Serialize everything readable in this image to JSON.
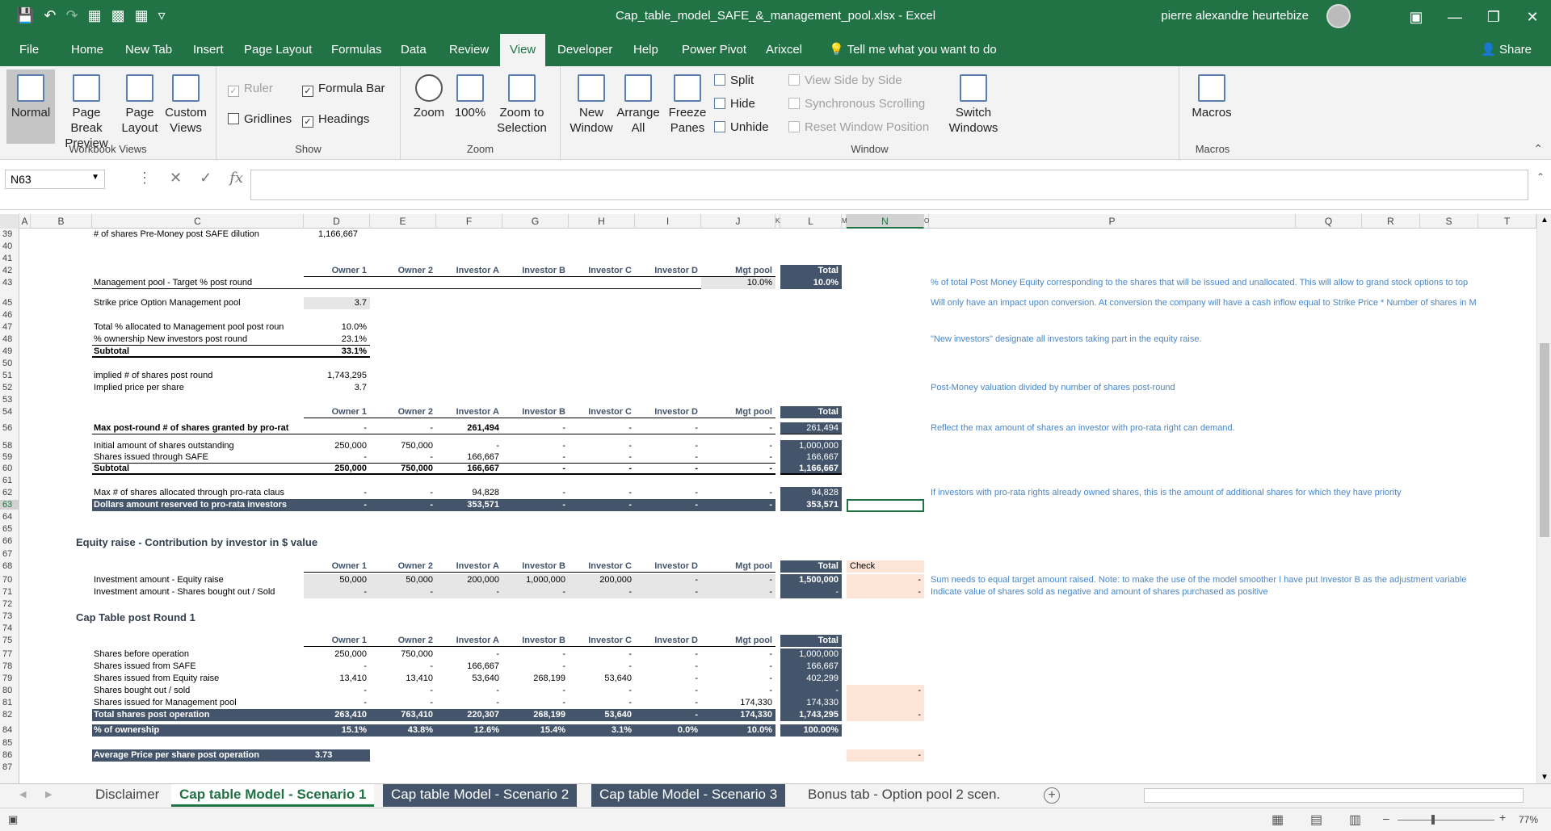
{
  "app": {
    "doc_title": "Cap_table_model_SAFE_&_management_pool.xlsx  -  Excel",
    "user": "pierre alexandre heurtebize",
    "share_label": "Share"
  },
  "menu": [
    "File",
    "Home",
    "New Tab",
    "Insert",
    "Page Layout",
    "Formulas",
    "Data",
    "Review",
    "View",
    "Developer",
    "Help",
    "Power Pivot",
    "Arixcel",
    "Tell me what you want to do"
  ],
  "ribbon": {
    "workbook_views": {
      "label": "Workbook Views",
      "normal": "Normal",
      "page_break": "Page Break Preview",
      "page_layout": "Page Layout",
      "custom_views": "Custom Views"
    },
    "show": {
      "label": "Show",
      "ruler": "Ruler",
      "formula_bar": "Formula Bar",
      "gridlines": "Gridlines",
      "headings": "Headings"
    },
    "zoom": {
      "label": "Zoom",
      "zoom": "Zoom",
      "hundred": "100%",
      "zoom_sel": "Zoom to Selection"
    },
    "window": {
      "label": "Window",
      "new_window": "New Window",
      "arrange": "Arrange All",
      "freeze": "Freeze Panes",
      "split": "Split",
      "hide": "Hide",
      "unhide": "Unhide",
      "side": "View Side by Side",
      "sync": "Synchronous Scrolling",
      "reset": "Reset Window Position",
      "switch": "Switch Windows"
    },
    "macros": {
      "label": "Macros",
      "macros": "Macros"
    }
  },
  "formula_bar": {
    "name_box": "N63",
    "formula": ""
  },
  "columns": [
    "A",
    "B",
    "C",
    "D",
    "E",
    "F",
    "G",
    "H",
    "I",
    "J",
    "K",
    "L",
    "M",
    "N",
    "O",
    "P",
    "Q",
    "R",
    "S",
    "T"
  ],
  "rows": [
    "39",
    "40",
    "41",
    "42",
    "43",
    "45",
    "46",
    "47",
    "48",
    "49",
    "50",
    "51",
    "52",
    "53",
    "54",
    "56",
    "58",
    "59",
    "60",
    "61",
    "62",
    "63",
    "64",
    "65",
    "66",
    "67",
    "68",
    "70",
    "71",
    "72",
    "73",
    "74",
    "75",
    "77",
    "78",
    "79",
    "80",
    "81",
    "82",
    "84",
    "85",
    "86",
    "87"
  ],
  "hdr": [
    "Owner 1",
    "Owner 2",
    "Investor A",
    "Investor B",
    "Investor C",
    "Investor D",
    "Mgt pool",
    "Total"
  ],
  "sheet": {
    "r39": {
      "label": "# of shares Pre-Money post SAFE dilution",
      "d": "1,166,667"
    },
    "r43": {
      "label": "Management pool - Target % post round",
      "j": "10.0%",
      "total": "10.0%",
      "note": "% of total Post Money Equity corresponding to the shares that will be issued and unallocated. This will allow to grand stock options to top"
    },
    "r45": {
      "label": "Strike price Option Management pool",
      "d": "3.7",
      "note": "Will only have an impact upon conversion. At conversion the company will have a cash inflow equal to Strike Price * Number of shares in M"
    },
    "r47": {
      "label": "Total % allocated to Management pool post roun",
      "d": "10.0%"
    },
    "r48": {
      "label": "% ownership New investors post round",
      "d": "23.1%",
      "note": "\"New investors\" designate all investors taking part in the equity raise."
    },
    "r49": {
      "label": "Subtotal",
      "d": "33.1%"
    },
    "r51": {
      "label": "implied # of shares post round",
      "d": "1,743,295"
    },
    "r52": {
      "label": "Implied price per share",
      "d": "3.7",
      "note": "Post-Money valuation divided by number of shares post-round"
    },
    "r56": {
      "label": "Max post-round # of shares granted by pro-rat",
      "vals": [
        "-",
        "-",
        "261,494",
        "-",
        "-",
        "-",
        "-",
        "261,494"
      ],
      "note": "Reflect the max amount of shares an investor with pro-rata right can demand."
    },
    "r58": {
      "label": "Initial amount of shares outstanding",
      "vals": [
        "250,000",
        "750,000",
        "-",
        "-",
        "-",
        "-",
        "-",
        "1,000,000"
      ]
    },
    "r59": {
      "label": "Shares issued through SAFE",
      "vals": [
        "-",
        "-",
        "166,667",
        "-",
        "-",
        "-",
        "-",
        "166,667"
      ]
    },
    "r60": {
      "label": "Subtotal",
      "vals": [
        "250,000",
        "750,000",
        "166,667",
        "-",
        "-",
        "-",
        "-",
        "1,166,667"
      ]
    },
    "r62": {
      "label": "Max # of shares allocated through pro-rata claus",
      "vals": [
        "-",
        "-",
        "94,828",
        "-",
        "-",
        "-",
        "-",
        "94,828"
      ],
      "note": "If investors with pro-rata rights already owned shares, this is the amount of additional shares for which they have priority"
    },
    "r63": {
      "label": "Dollars amount reserved to pro-rata investors",
      "vals": [
        "-",
        "-",
        "353,571",
        "-",
        "-",
        "-",
        "-",
        "353,571"
      ]
    },
    "r66": {
      "label": "Equity raise - Contribution by investor in $ value"
    },
    "r68": {
      "check": "Check"
    },
    "r70": {
      "label": "Investment amount - Equity raise",
      "vals": [
        "50,000",
        "50,000",
        "200,000",
        "1,000,000",
        "200,000",
        "-",
        "-",
        "1,500,000"
      ],
      "n": "-",
      "note": "Sum needs to equal target amount raised. Note: to make the use of the model smoother I have put Investor B as the adjustment variable"
    },
    "r71": {
      "label": "Investment amount - Shares bought out / Sold",
      "vals": [
        "-",
        "-",
        "-",
        "-",
        "-",
        "-",
        "-",
        "-"
      ],
      "n": "-",
      "note": "Indicate value of shares sold as negative and amount of shares purchased as positive"
    },
    "r73": {
      "label": "Cap Table post Round 1"
    },
    "r77": {
      "label": "Shares before operation",
      "vals": [
        "250,000",
        "750,000",
        "-",
        "-",
        "-",
        "-",
        "-",
        "1,000,000"
      ]
    },
    "r78": {
      "label": "Shares issued from SAFE",
      "vals": [
        "-",
        "-",
        "166,667",
        "-",
        "-",
        "-",
        "-",
        "166,667"
      ]
    },
    "r79": {
      "label": "Shares issued from Equity raise",
      "vals": [
        "13,410",
        "13,410",
        "53,640",
        "268,199",
        "53,640",
        "-",
        "-",
        "402,299"
      ]
    },
    "r80": {
      "label": "Shares bought out / sold",
      "vals": [
        "-",
        "-",
        "-",
        "-",
        "-",
        "-",
        "-",
        "-"
      ],
      "n": "-"
    },
    "r81": {
      "label": "Shares issued for Management pool",
      "vals": [
        "-",
        "-",
        "-",
        "-",
        "-",
        "-",
        "174,330",
        "174,330"
      ]
    },
    "r82": {
      "label": "Total shares post operation",
      "vals": [
        "263,410",
        "763,410",
        "220,307",
        "268,199",
        "53,640",
        "-",
        "174,330",
        "1,743,295"
      ],
      "n": "-"
    },
    "r84": {
      "label": "% of ownership",
      "vals": [
        "15.1%",
        "43.8%",
        "12.6%",
        "15.4%",
        "3.1%",
        "0.0%",
        "10.0%",
        "100.00%"
      ]
    },
    "r86": {
      "label": "Average Price per share post operation",
      "d": "3.73",
      "n": "-"
    }
  },
  "sheet_tabs": [
    "Disclaimer",
    "Cap table Model - Scenario 1",
    "Cap table Model - Scenario 2",
    "Cap table Model - Scenario 3",
    "Bonus tab - Option pool 2 scen."
  ],
  "status": {
    "zoom": "77%"
  }
}
